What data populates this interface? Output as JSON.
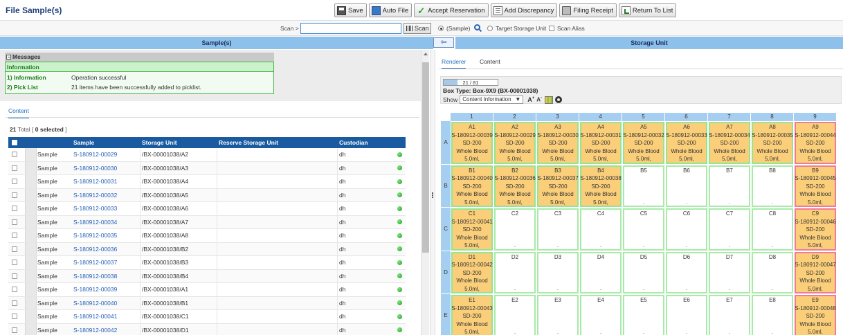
{
  "page_title": "File Sample(s)",
  "toolbar": {
    "save": "Save",
    "auto_file": "Auto File",
    "accept_reservation": "Accept Reservation",
    "add_discrepancy": "Add Discrepancy",
    "filing_receipt": "Filing Receipt",
    "return_to_list": "Return To List"
  },
  "scan": {
    "label": "Scan >",
    "input_value": "",
    "button": "Scan",
    "opt_sample": "(Sample)",
    "opt_target": "Target Storage Unit",
    "opt_alias": "Scan Alias"
  },
  "left_header": "Sample(s)",
  "right_header": "Storage Unit",
  "arrow_glyph": "⇦",
  "messages": {
    "title": "Messages",
    "info_title": "Information",
    "rows": [
      {
        "key": "1) Information",
        "value": "Operation successful"
      },
      {
        "key": "2) Pick List",
        "value": "21 items have been successfully added to picklist."
      }
    ]
  },
  "content_tab": "Content",
  "total": {
    "count": "21",
    "label": "Total [",
    "selected": "0 selected",
    "close": "]"
  },
  "grid": {
    "headers": {
      "sample": "Sample",
      "unit": "Storage Unit",
      "reserve": "Reserve Storage Unit",
      "custodian": "Custodian"
    },
    "rows": [
      {
        "type": "Sample",
        "sample": "S-180912-00029",
        "unit": "/BX-00001038/A2",
        "reserve": "",
        "custodian": "dh"
      },
      {
        "type": "Sample",
        "sample": "S-180912-00030",
        "unit": "/BX-00001038/A3",
        "reserve": "",
        "custodian": "dh"
      },
      {
        "type": "Sample",
        "sample": "S-180912-00031",
        "unit": "/BX-00001038/A4",
        "reserve": "",
        "custodian": "dh"
      },
      {
        "type": "Sample",
        "sample": "S-180912-00032",
        "unit": "/BX-00001038/A5",
        "reserve": "",
        "custodian": "dh"
      },
      {
        "type": "Sample",
        "sample": "S-180912-00033",
        "unit": "/BX-00001038/A6",
        "reserve": "",
        "custodian": "dh"
      },
      {
        "type": "Sample",
        "sample": "S-180912-00034",
        "unit": "/BX-00001038/A7",
        "reserve": "",
        "custodian": "dh"
      },
      {
        "type": "Sample",
        "sample": "S-180912-00035",
        "unit": "/BX-00001038/A8",
        "reserve": "",
        "custodian": "dh"
      },
      {
        "type": "Sample",
        "sample": "S-180912-00036",
        "unit": "/BX-00001038/B2",
        "reserve": "",
        "custodian": "dh"
      },
      {
        "type": "Sample",
        "sample": "S-180912-00037",
        "unit": "/BX-00001038/B3",
        "reserve": "",
        "custodian": "dh"
      },
      {
        "type": "Sample",
        "sample": "S-180912-00038",
        "unit": "/BX-00001038/B4",
        "reserve": "",
        "custodian": "dh"
      },
      {
        "type": "Sample",
        "sample": "S-180912-00039",
        "unit": "/BX-00001038/A1",
        "reserve": "",
        "custodian": "dh"
      },
      {
        "type": "Sample",
        "sample": "S-180912-00040",
        "unit": "/BX-00001038/B1",
        "reserve": "",
        "custodian": "dh"
      },
      {
        "type": "Sample",
        "sample": "S-180912-00041",
        "unit": "/BX-00001038/C1",
        "reserve": "",
        "custodian": "dh"
      },
      {
        "type": "Sample",
        "sample": "S-180912-00042",
        "unit": "/BX-00001038/D1",
        "reserve": "",
        "custodian": "dh"
      }
    ]
  },
  "right_tabs": {
    "renderer": "Renderer",
    "content": "Content"
  },
  "box": {
    "progress_text": "21 / 81",
    "progress_fraction": 0.26,
    "type_label": "Box Type: Box-9X9 (BX-00001038)",
    "show_label": "Show",
    "show_value": "Content Information",
    "aa_big": "A",
    "aa_small": "A",
    "columns": [
      "1",
      "2",
      "3",
      "4",
      "5",
      "6",
      "7",
      "8",
      "9"
    ],
    "rows": [
      {
        "label": "A",
        "cells": [
          {
            "pos": "A1",
            "state": "filled",
            "sample": "S-180912-00039",
            "size": "SD-200",
            "kind": "Whole Blood",
            "vol": "5.0ml,"
          },
          {
            "pos": "A2",
            "state": "filled",
            "sample": "S-180912-00029",
            "size": "SD-200",
            "kind": "Whole Blood",
            "vol": "5.0ml,"
          },
          {
            "pos": "A3",
            "state": "filled",
            "sample": "S-180912-00030",
            "size": "SD-200",
            "kind": "Whole Blood",
            "vol": "5.0ml,"
          },
          {
            "pos": "A4",
            "state": "filled",
            "sample": "S-180912-00031",
            "size": "SD-200",
            "kind": "Whole Blood",
            "vol": "5.0ml,"
          },
          {
            "pos": "A5",
            "state": "filled",
            "sample": "S-180912-00032",
            "size": "SD-200",
            "kind": "Whole Blood",
            "vol": "5.0ml,"
          },
          {
            "pos": "A6",
            "state": "filled",
            "sample": "S-180912-00033",
            "size": "SD-200",
            "kind": "Whole Blood",
            "vol": "5.0ml,"
          },
          {
            "pos": "A7",
            "state": "filled",
            "sample": "S-180912-00034",
            "size": "SD-200",
            "kind": "Whole Blood",
            "vol": "5.0ml,"
          },
          {
            "pos": "A8",
            "state": "filled",
            "sample": "S-180912-00035",
            "size": "SD-200",
            "kind": "Whole Blood",
            "vol": "5.0ml,"
          },
          {
            "pos": "A9",
            "state": "alert",
            "sample": "S-180912-00044",
            "size": "SD-200",
            "kind": "Whole Blood",
            "vol": "5.0ml,"
          }
        ]
      },
      {
        "label": "B",
        "cells": [
          {
            "pos": "B1",
            "state": "filled",
            "sample": "S-180912-00040",
            "size": "SD-200",
            "kind": "Whole Blood",
            "vol": "5.0ml,"
          },
          {
            "pos": "B2",
            "state": "filled",
            "sample": "S-180912-00036",
            "size": "SD-200",
            "kind": "Whole Blood",
            "vol": "5.0ml,"
          },
          {
            "pos": "B3",
            "state": "filled",
            "sample": "S-180912-00037",
            "size": "SD-200",
            "kind": "Whole Blood",
            "vol": "5.0ml,"
          },
          {
            "pos": "B4",
            "state": "filled",
            "sample": "S-180912-00038",
            "size": "SD-200",
            "kind": "Whole Blood",
            "vol": "5.0ml,"
          },
          {
            "pos": "B5",
            "state": "empty"
          },
          {
            "pos": "B6",
            "state": "empty"
          },
          {
            "pos": "B7",
            "state": "empty"
          },
          {
            "pos": "B8",
            "state": "empty"
          },
          {
            "pos": "B9",
            "state": "alert",
            "sample": "S-180912-00045",
            "size": "SD-200",
            "kind": "Whole Blood",
            "vol": "5.0ml,"
          }
        ]
      },
      {
        "label": "C",
        "cells": [
          {
            "pos": "C1",
            "state": "filled",
            "sample": "S-180912-00041",
            "size": "SD-200",
            "kind": "Whole Blood",
            "vol": "5.0ml,"
          },
          {
            "pos": "C2",
            "state": "empty"
          },
          {
            "pos": "C3",
            "state": "empty"
          },
          {
            "pos": "C4",
            "state": "empty"
          },
          {
            "pos": "C5",
            "state": "empty"
          },
          {
            "pos": "C6",
            "state": "empty"
          },
          {
            "pos": "C7",
            "state": "empty"
          },
          {
            "pos": "C8",
            "state": "empty"
          },
          {
            "pos": "C9",
            "state": "alert",
            "sample": "S-180912-00046",
            "size": "SD-200",
            "kind": "Whole Blood",
            "vol": "5.0ml,"
          }
        ]
      },
      {
        "label": "D",
        "cells": [
          {
            "pos": "D1",
            "state": "filled",
            "sample": "S-180912-00042",
            "size": "SD-200",
            "kind": "Whole Blood",
            "vol": "5.0ml,"
          },
          {
            "pos": "D2",
            "state": "empty"
          },
          {
            "pos": "D3",
            "state": "empty"
          },
          {
            "pos": "D4",
            "state": "empty"
          },
          {
            "pos": "D5",
            "state": "empty"
          },
          {
            "pos": "D6",
            "state": "empty"
          },
          {
            "pos": "D7",
            "state": "empty"
          },
          {
            "pos": "D8",
            "state": "empty"
          },
          {
            "pos": "D9",
            "state": "alert",
            "sample": "S-180912-00047",
            "size": "SD-200",
            "kind": "Whole Blood",
            "vol": "5.0ml,"
          }
        ]
      },
      {
        "label": "E",
        "cells": [
          {
            "pos": "E1",
            "state": "filled",
            "sample": "S-180912-00043",
            "size": "SD-200",
            "kind": "Whole Blood",
            "vol": "5.0ml,"
          },
          {
            "pos": "E2",
            "state": "empty"
          },
          {
            "pos": "E3",
            "state": "empty"
          },
          {
            "pos": "E4",
            "state": "empty"
          },
          {
            "pos": "E5",
            "state": "empty"
          },
          {
            "pos": "E6",
            "state": "empty"
          },
          {
            "pos": "E7",
            "state": "empty"
          },
          {
            "pos": "E8",
            "state": "empty"
          },
          {
            "pos": "E9",
            "state": "alert",
            "sample": "S-180912-00048",
            "size": "SD-200",
            "kind": "Whole Blood",
            "vol": "5.0ml,"
          }
        ]
      }
    ]
  },
  "colors": {
    "accent": "#1a5aa0",
    "header_blue": "#8ec0ec",
    "filled": "#fbcf7a",
    "empty_border": "#93e493",
    "alert_border": "#f07a9a"
  }
}
